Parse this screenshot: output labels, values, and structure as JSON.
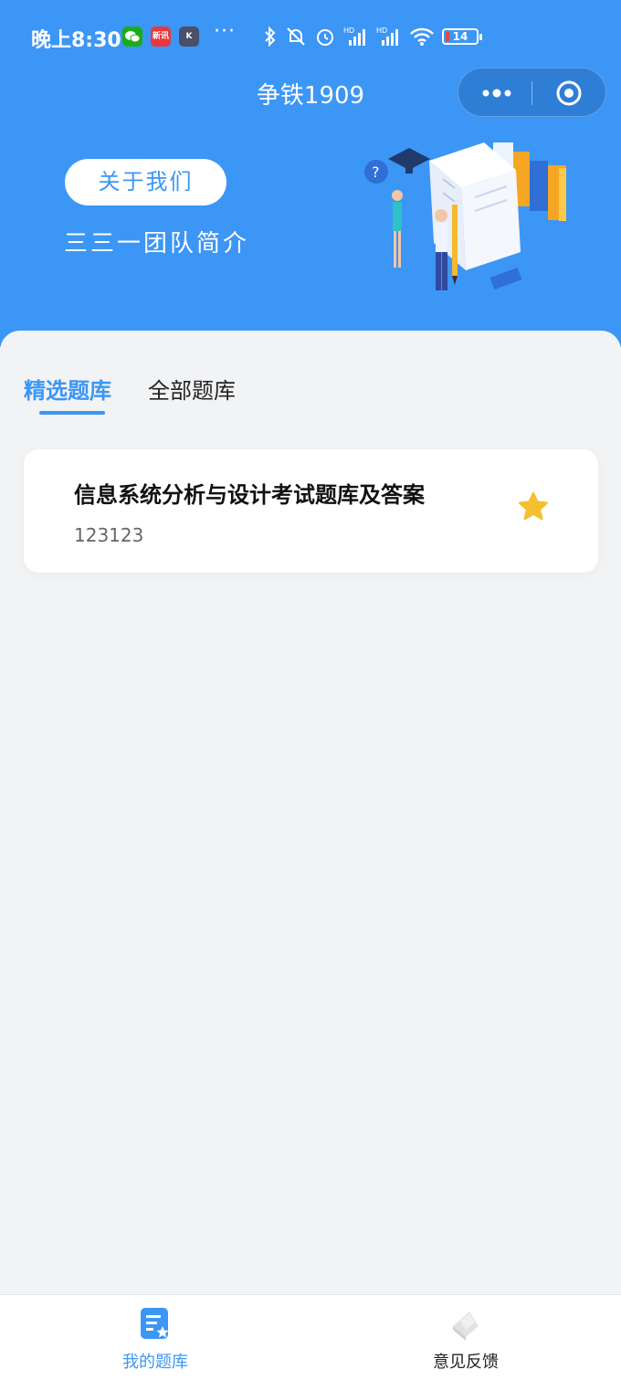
{
  "status_bar": {
    "time": "晚上8:30",
    "app_icons": [
      {
        "name": "wechat-icon",
        "text": "",
        "color": "#1aad19"
      },
      {
        "name": "news-app-icon",
        "text": "新讯",
        "color": "#e8383d"
      },
      {
        "name": "k-app-icon",
        "text": "K",
        "color": "#4a4f6a"
      }
    ],
    "more": "···",
    "battery": "14"
  },
  "nav": {
    "title": "争铁1909",
    "capsule_more_icon": "more-dots-icon",
    "capsule_close_icon": "target-close-icon"
  },
  "banner": {
    "about_button": "关于我们",
    "team_intro": "三三一团队简介"
  },
  "tabs": [
    {
      "label": "精选题库",
      "active": true
    },
    {
      "label": "全部题库",
      "active": false
    }
  ],
  "bank_list": [
    {
      "title": "信息系统分析与设计考试题库及答案",
      "subtitle": "123123",
      "favorite_icon": "star-icon"
    }
  ],
  "tabbar": [
    {
      "label": "我的题库",
      "icon": "question-bank-icon",
      "active": true
    },
    {
      "label": "意见反馈",
      "icon": "feedback-icon",
      "active": false
    }
  ],
  "colors": {
    "primary": "#3c96f5",
    "star": "#f5c030",
    "background": "#f2f3f5"
  }
}
